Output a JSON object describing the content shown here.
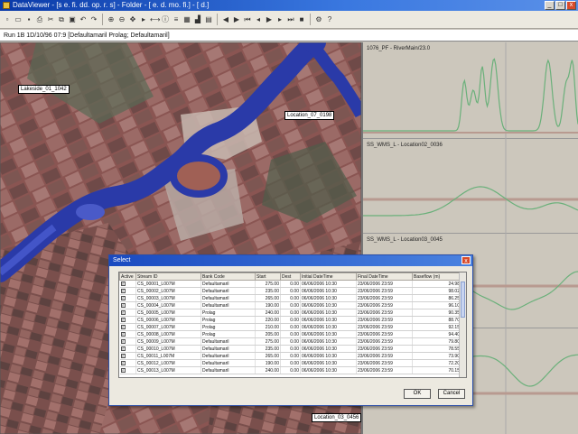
{
  "window": {
    "title": "DataViewer - [s e. fi. dd. op. r. s] - Folder - [ e. d. mo. fi.] - [ d.]",
    "buttons": [
      "_",
      "□",
      "x"
    ]
  },
  "toolbar": {
    "icons": [
      "new-icon",
      "open-icon",
      "save-icon",
      "print-icon",
      "cut-icon",
      "copy-icon",
      "paste-icon",
      "undo-icon",
      "redo-icon",
      "zoom-in-icon",
      "zoom-out-icon",
      "pan-icon",
      "select-icon",
      "measure-icon",
      "identify-icon",
      "layers-icon",
      "grid-icon",
      "chart-icon",
      "table-icon",
      "back-icon",
      "forward-icon",
      "first-icon",
      "prev-icon",
      "play-icon",
      "next-icon",
      "last-icon",
      "stop-icon",
      "settings-icon",
      "help-icon"
    ]
  },
  "pathbar": {
    "text": "Run 1B   1D/10/96 07:9   [Defaultamaril Prolag; Defaultamaril]"
  },
  "map": {
    "labels": [
      "Lakeside_01_1042",
      "Location_07_0198",
      "Location_03_0456"
    ]
  },
  "graphs": [
    {
      "title": "1076_PF - RiverMain/23.0",
      "line_color": "#6ab07a"
    },
    {
      "title": "SS_WMS_L - Location02_0036",
      "line_color": "#6ab07a"
    },
    {
      "title": "SS_WMS_L - Location03_0045",
      "line_color": "#6ab07a"
    },
    {
      "title": "",
      "line_color": "#6ab07a"
    }
  ],
  "dialog": {
    "title": "Select",
    "columns": [
      "Active",
      "Stream ID",
      "Bank Code",
      "Start",
      "Dest",
      "Initial DateTime",
      "Final DateTime",
      "Baseflow (m)"
    ],
    "rows": [
      [
        "√",
        "CS_00001_L007M",
        "Defaultamaril",
        "275.00",
        "0.00",
        "06/06/2006 10:30",
        "23/06/2006 23:59",
        "24.98"
      ],
      [
        "√",
        "CS_00002_L007M",
        "Defaultamaril",
        "235.00",
        "0.00",
        "06/06/2006 10:30",
        "23/06/2006 23:59",
        "98.02"
      ],
      [
        "√",
        "CS_00003_L007M",
        "Defaultamaril",
        "265.00",
        "0.00",
        "06/06/2006 10:30",
        "23/06/2006 23:59",
        "86.25"
      ],
      [
        "√",
        "CS_00004_L007M",
        "Defaultamaril",
        "190.00",
        "0.00",
        "06/06/2006 10:30",
        "23/06/2006 23:59",
        "96.10"
      ],
      [
        "√",
        "CS_00005_L007M",
        "Prolag",
        "240.00",
        "0.00",
        "06/06/2006 10:30",
        "23/06/2006 23:59",
        "90.35"
      ],
      [
        "√",
        "CS_00006_L007M",
        "Prolag",
        "220.00",
        "0.00",
        "06/06/2006 10:30",
        "23/06/2006 23:59",
        "88.70"
      ],
      [
        "√",
        "CS_00007_L007M",
        "Prolag",
        "210.00",
        "0.00",
        "06/06/2006 10:30",
        "23/06/2006 23:59",
        "92.15"
      ],
      [
        "√",
        "CS_00008_L007M",
        "Prolag",
        "205.00",
        "0.00",
        "06/06/2006 10:30",
        "23/06/2006 23:59",
        "94.40"
      ],
      [
        "√",
        "CS_00009_L007M",
        "Defaultamaril",
        "275.00",
        "0.00",
        "06/06/2006 10:30",
        "23/06/2006 23:59",
        "79.80"
      ],
      [
        "√",
        "CS_00010_L007M",
        "Defaultamaril",
        "235.00",
        "0.00",
        "06/06/2006 10:30",
        "23/06/2006 23:59",
        "78.55"
      ],
      [
        "√",
        "CS_00011_L007M",
        "Defaultamaril",
        "265.00",
        "0.00",
        "06/06/2006 10:30",
        "23/06/2006 23:59",
        "73.90"
      ],
      [
        "√",
        "CS_00012_L007M",
        "Defaultamaril",
        "190.00",
        "0.00",
        "06/06/2006 10:30",
        "23/06/2006 23:59",
        "72.20"
      ],
      [
        "√",
        "CS_00013_L007M",
        "Defaultamaril",
        "240.00",
        "0.00",
        "06/06/2006 10:30",
        "23/06/2006 23:59",
        "70.15"
      ]
    ],
    "ok_label": "OK",
    "cancel_label": "Cancel"
  },
  "colors": {
    "river": "#2a3aa8",
    "terrain": "#8a5a55",
    "graph_bg": "#ccc7bc",
    "dialog_title": "#1a4ac0"
  }
}
